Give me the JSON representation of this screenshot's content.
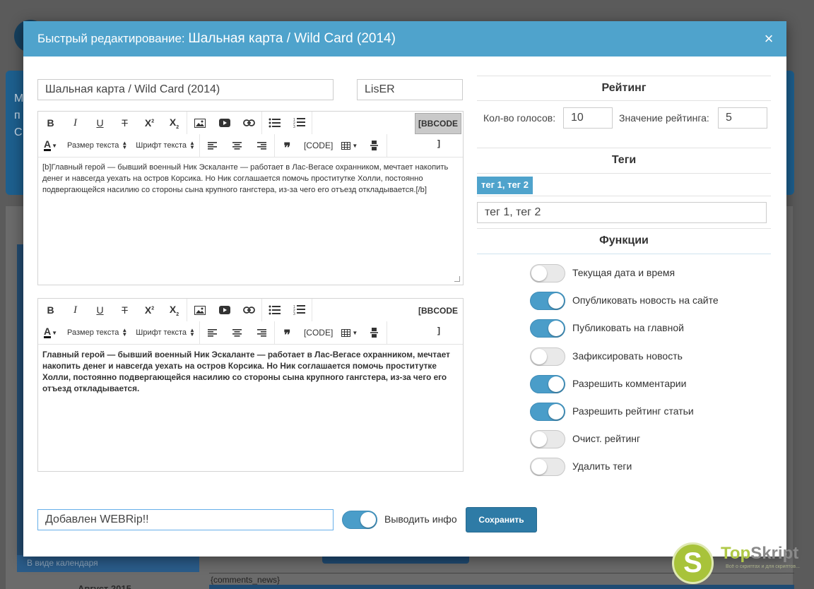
{
  "background": {
    "letters": [
      "М",
      "п",
      "С"
    ],
    "calendar_label": "В виде календаря",
    "calendar_month": "Август 2015",
    "comments_placeholder": "{comments_news}"
  },
  "modal": {
    "title_prefix": "Быстрый редактирование:",
    "title_main": "Шальная карта / Wild Card (2014)",
    "close_glyph": "×",
    "title_field": "Шальная карта / Wild Card (2014)",
    "author_field": "LisER"
  },
  "toolbar": {
    "bold": "B",
    "italic": "I",
    "underline": "U",
    "strike": "T",
    "size_label": "Размер текста",
    "font_label": "Шрифт текста",
    "code_label": "[CODE]",
    "bbcode_label": "[BBCODE",
    "bbcode_close": "]"
  },
  "editor_short": {
    "text": "[b]Главный герой — бывший военный Ник Эскаланте — работает в Лас-Вегасе охранником, мечтает накопить денег и навсегда уехать на остров Корсика. Но Ник соглашается помочь проститутке Холли, постоянно подвергающейся насилию со стороны сына крупного гангстера, из-за чего его отъезд откладывается.[/b]"
  },
  "editor_full": {
    "text": "Главный герой — бывший военный Ник Эскаланте — работает в Лас-Вегасе охранником, мечтает накопить денег и навсегда уехать на остров Корсика. Но Ник соглашается помочь проститутке Холли, постоянно подвергающейся насилию со стороны сына крупного гангстера, из-за чего его отъезд откладывается."
  },
  "rating": {
    "title": "Рейтинг",
    "votes_label": "Кол-во голосов:",
    "votes_value": "10",
    "rating_label": "Значение рейтинга:",
    "rating_value": "5"
  },
  "tags": {
    "title": "Теги",
    "chip": "тег 1, тег 2",
    "input_value": "тег 1, тег 2"
  },
  "functions": {
    "title": "Функции",
    "items": [
      {
        "label": "Текущая дата и время",
        "on": false
      },
      {
        "label": "Опубликовать новость на сайте",
        "on": true
      },
      {
        "label": "Публиковать на главной",
        "on": true
      },
      {
        "label": "Зафиксировать новость",
        "on": false
      },
      {
        "label": "Разрешить комментарии",
        "on": true
      },
      {
        "label": "Разрешить рейтинг статьи",
        "on": true
      },
      {
        "label": "Очист. рейтинг",
        "on": false
      },
      {
        "label": "Удалить теги",
        "on": false
      }
    ]
  },
  "footer": {
    "info_field": "Добавлен WEBRip!!",
    "info_switch_on": true,
    "info_label": "Выводить инфо",
    "save_label": "Сохранить"
  },
  "watermark": {
    "logo_letter": "S",
    "brand_a": "Top",
    "brand_b": "Skript",
    "tagline": "Всё о скриптах и для скриптов..."
  },
  "colors": {
    "header": "#4fa3cc",
    "switch_on": "#4a9dc9",
    "save_button": "#2e7ba6",
    "watermark_green": "#a8c33a"
  }
}
